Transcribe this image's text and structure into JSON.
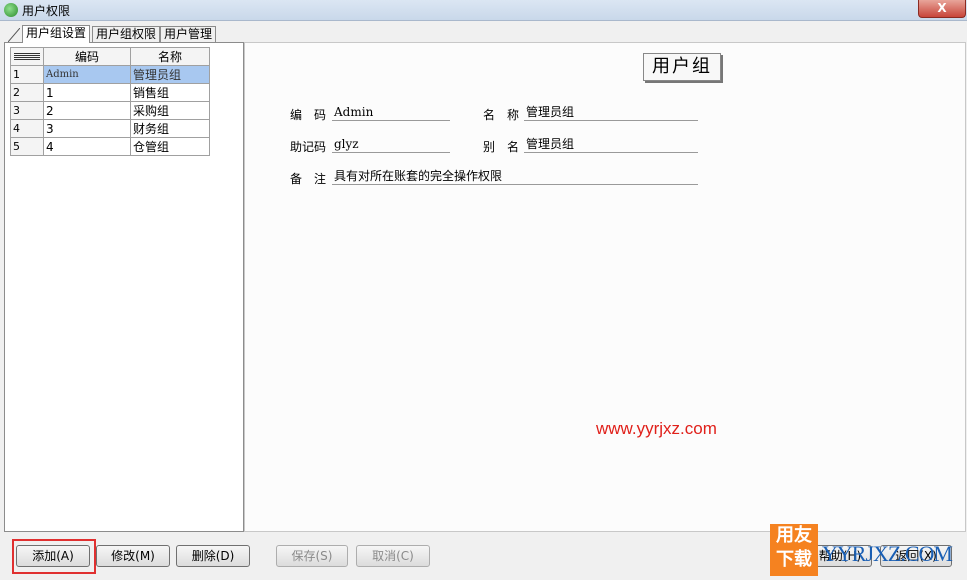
{
  "window": {
    "title": "用户权限",
    "close_label": "X"
  },
  "tabs": [
    "用户组设置",
    "用户组权限",
    "用户管理"
  ],
  "grid": {
    "headers": [
      "",
      "编码",
      "名称"
    ],
    "rows": [
      {
        "num": "1",
        "code": "Admin",
        "name": "管理员组"
      },
      {
        "num": "2",
        "code": "1",
        "name": "销售组"
      },
      {
        "num": "3",
        "code": "2",
        "name": "采购组"
      },
      {
        "num": "4",
        "code": "3",
        "name": "财务组"
      },
      {
        "num": "5",
        "code": "4",
        "name": "仓管组"
      }
    ]
  },
  "form": {
    "title": "用户组",
    "code_label": "编　码",
    "code_value": "Admin",
    "name_label": "名　称",
    "name_value": "管理员组",
    "mnemonic_label": "助记码",
    "mnemonic_value": "glyz",
    "alias_label": "别　名",
    "alias_value": "管理员组",
    "remark_label": "备　注",
    "remark_value": "具有对所在账套的完全操作权限"
  },
  "watermark": "www.yyrjxz.com",
  "buttons": {
    "add": "添加(A)",
    "edit": "修改(M)",
    "delete": "删除(D)",
    "save": "保存(S)",
    "cancel": "取消(C)",
    "help": "帮助(H)",
    "back": "返回(X)"
  },
  "logo": {
    "line1": "用友",
    "line2": "下载",
    "url": "YYRJXZ.COM"
  },
  "colors": {
    "selection": "#a8c8f0",
    "highlight": "#e03030",
    "watermark": "#e0201a",
    "logo_bg": "#f58220"
  }
}
